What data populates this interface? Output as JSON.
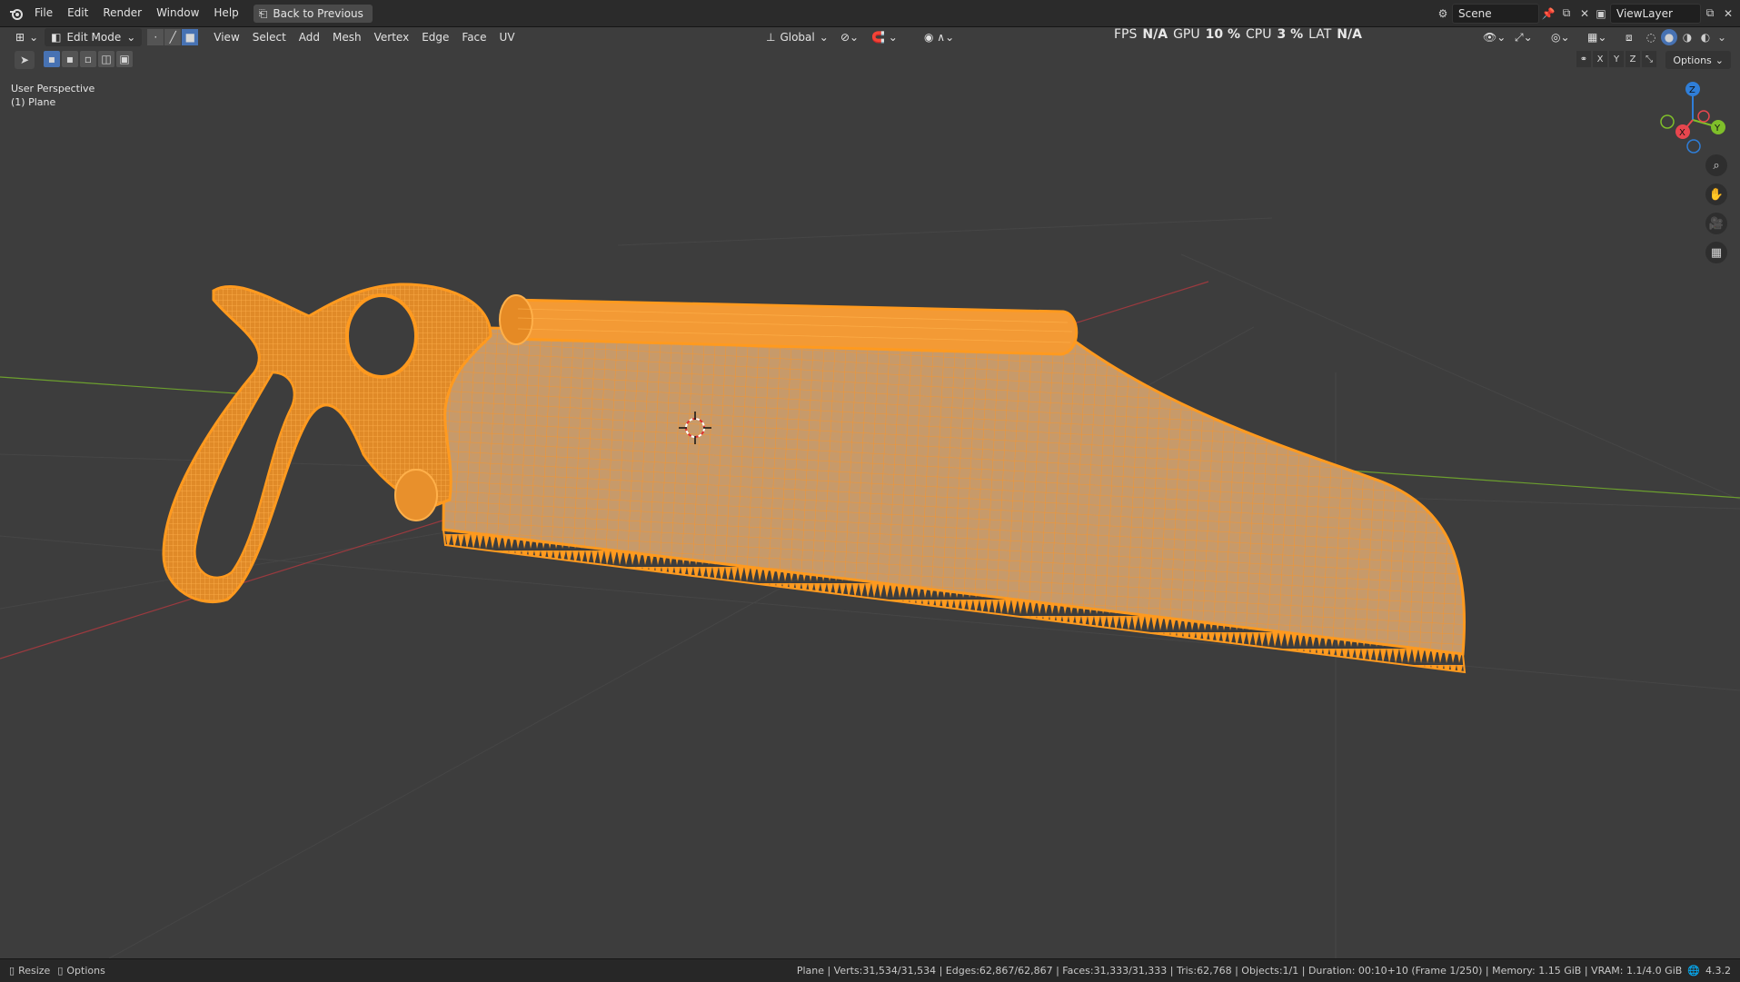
{
  "menu": {
    "items": [
      "File",
      "Edit",
      "Render",
      "Window",
      "Help"
    ],
    "back_label": "Back to Previous"
  },
  "scene": {
    "label": "Scene",
    "icon": "scene-icon"
  },
  "viewlayer": {
    "label": "ViewLayer",
    "icon": "viewlayer-icon"
  },
  "viewport_header": {
    "mode": "Edit Mode",
    "menus": [
      "View",
      "Select",
      "Add",
      "Mesh",
      "Vertex",
      "Edge",
      "Face",
      "UV"
    ],
    "orientation": "Global",
    "options": "Options"
  },
  "perf": {
    "fps_label": "FPS",
    "fps_value": "N/A",
    "gpu_label": "GPU",
    "gpu_value": "10 %",
    "cpu_label": "CPU",
    "cpu_value": "3 %",
    "lat_label": "LAT",
    "lat_value": "N/A"
  },
  "overlay": {
    "view_name": "User Perspective",
    "object_name": "(1) Plane"
  },
  "axes": {
    "x": "X",
    "y": "Y",
    "z": "Z"
  },
  "status": {
    "left_resize": "Resize",
    "left_options": "Options",
    "stats": "Plane | Verts:31,534/31,534 | Edges:62,867/62,867 | Faces:31,333/31,333 | Tris:62,768 | Objects:1/1 | Duration: 00:10+10 (Frame 1/250) | Memory: 1.15 GiB | VRAM: 1.1/4.0 GiB",
    "version": "4.3.2"
  },
  "colors": {
    "selection": "#ff9a1f",
    "viewport_bg": "#3d3d3d",
    "x_axis": "#e8464e",
    "y_axis": "#7fbf2a",
    "z_axis": "#2f7ed8",
    "accent": "#4772b3"
  }
}
